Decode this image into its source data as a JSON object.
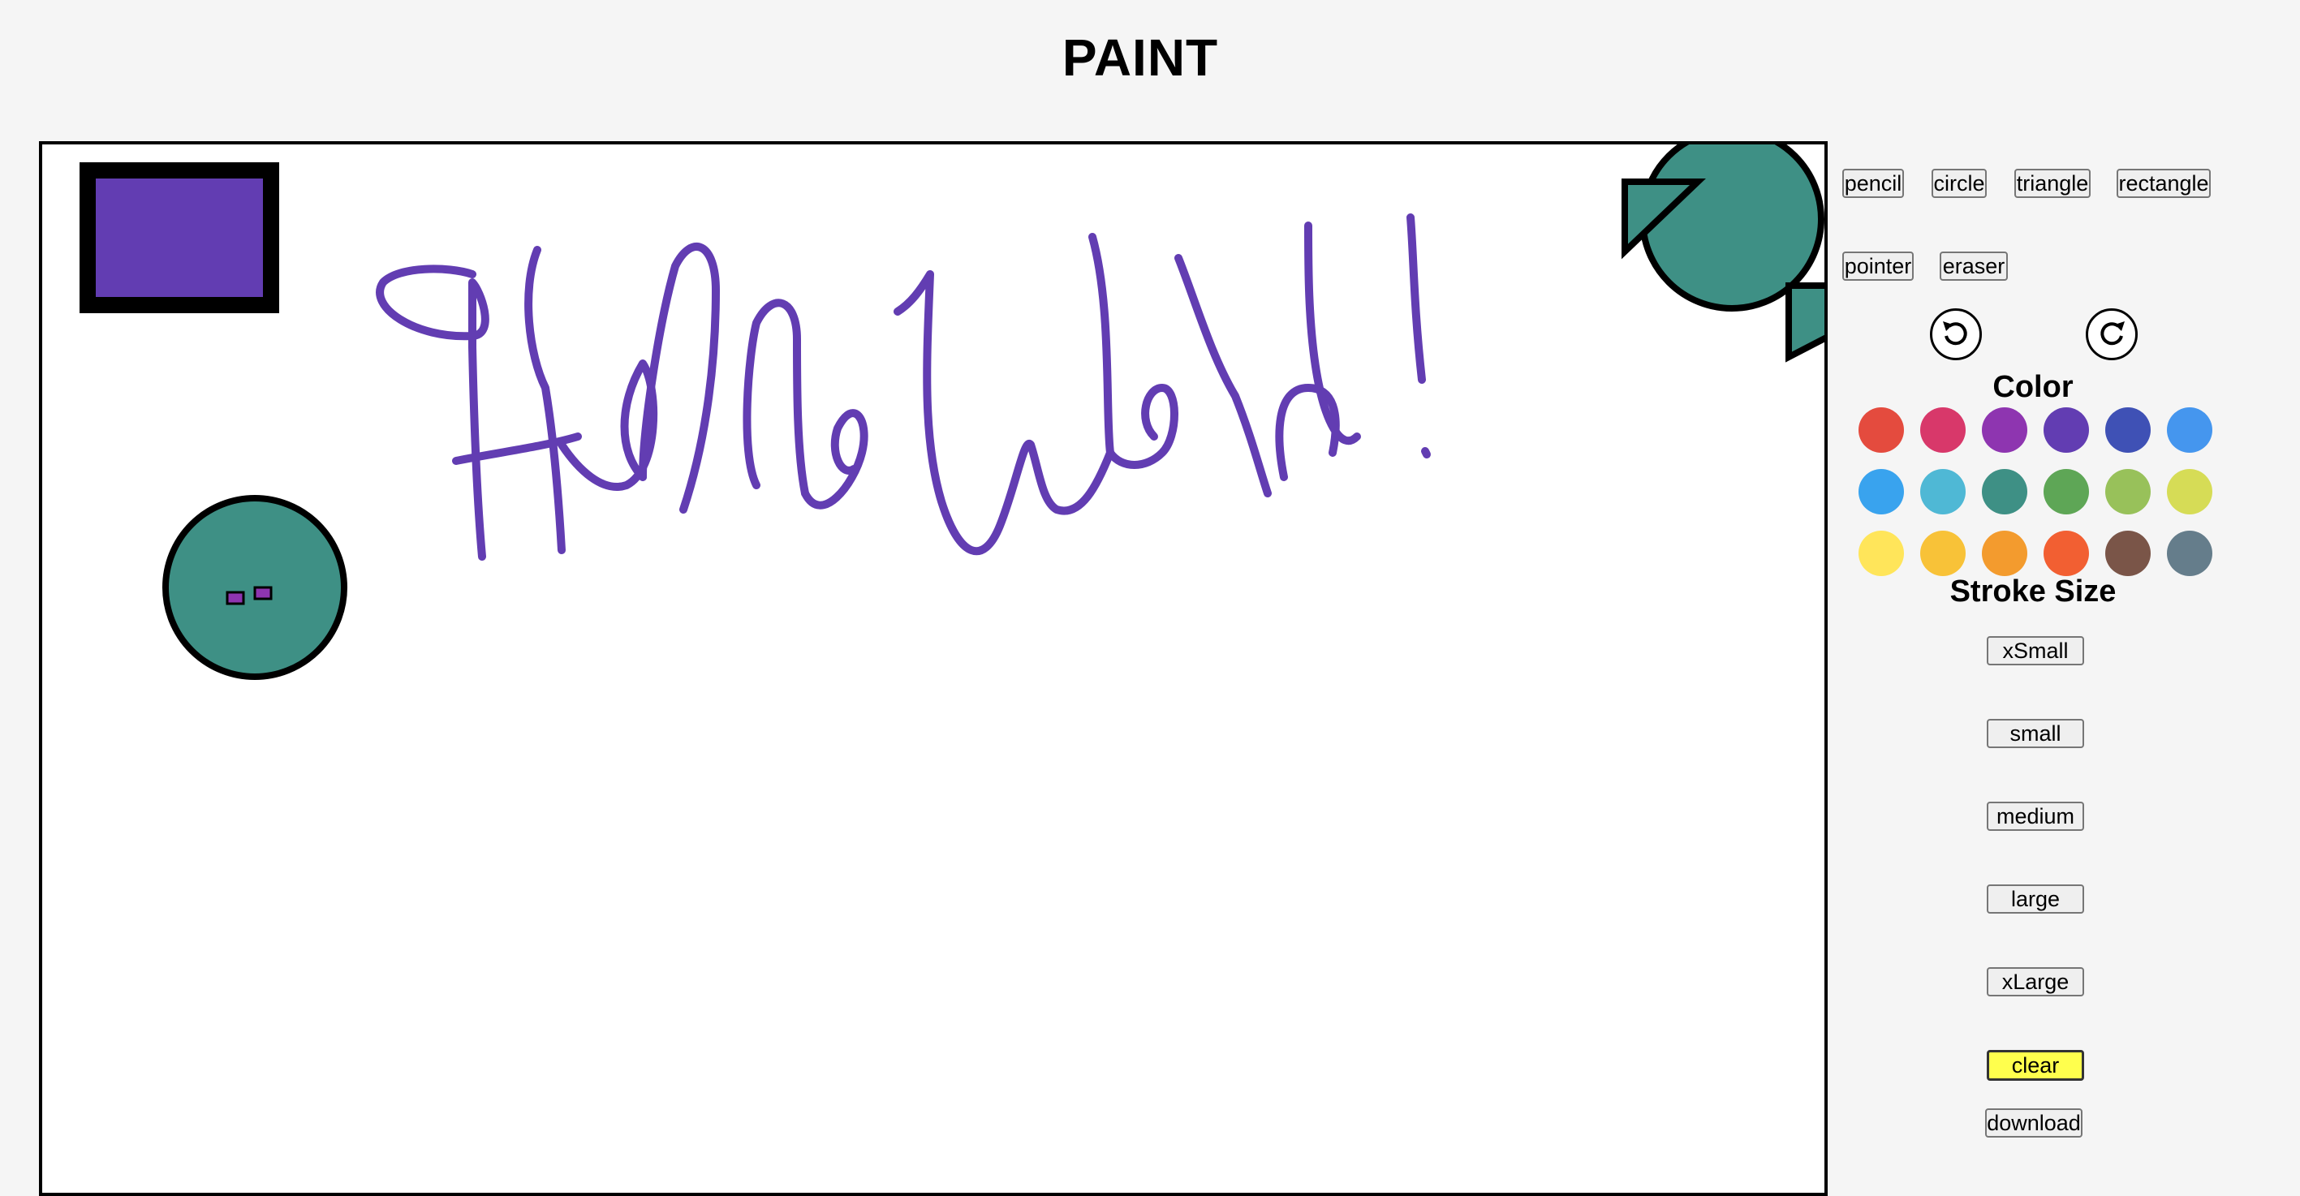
{
  "header": {
    "title": "PAINT"
  },
  "tools": {
    "pencil": "pencil",
    "circle": "circle",
    "triangle": "triangle",
    "rectangle": "rectangle",
    "pointer": "pointer",
    "eraser": "eraser"
  },
  "history": {
    "undo_icon": "undo-icon",
    "redo_icon": "redo-icon"
  },
  "color": {
    "label": "Color",
    "swatches": [
      "#e44b3e",
      "#d8386a",
      "#8e35b0",
      "#623db2",
      "#3f51b5",
      "#4596ee",
      "#39a3ee",
      "#4fb8d5",
      "#3e9085",
      "#5ea656",
      "#98c15a",
      "#d6dc56",
      "#ffe55a",
      "#f8c238",
      "#f39b2e",
      "#f25f32",
      "#7a5548",
      "#657d8b"
    ]
  },
  "stroke": {
    "label": "Stroke Size",
    "sizes": [
      "xSmall",
      "small",
      "medium",
      "large",
      "xLarge"
    ]
  },
  "actions": {
    "clear": "clear",
    "download": "download"
  },
  "canvas": {
    "drawn_text": "Hello World!",
    "stroke_color": "#623db2",
    "fill_colors": {
      "rectangle": "#623db2",
      "circle": "#3e9085",
      "accent": "#8e35b0"
    }
  }
}
